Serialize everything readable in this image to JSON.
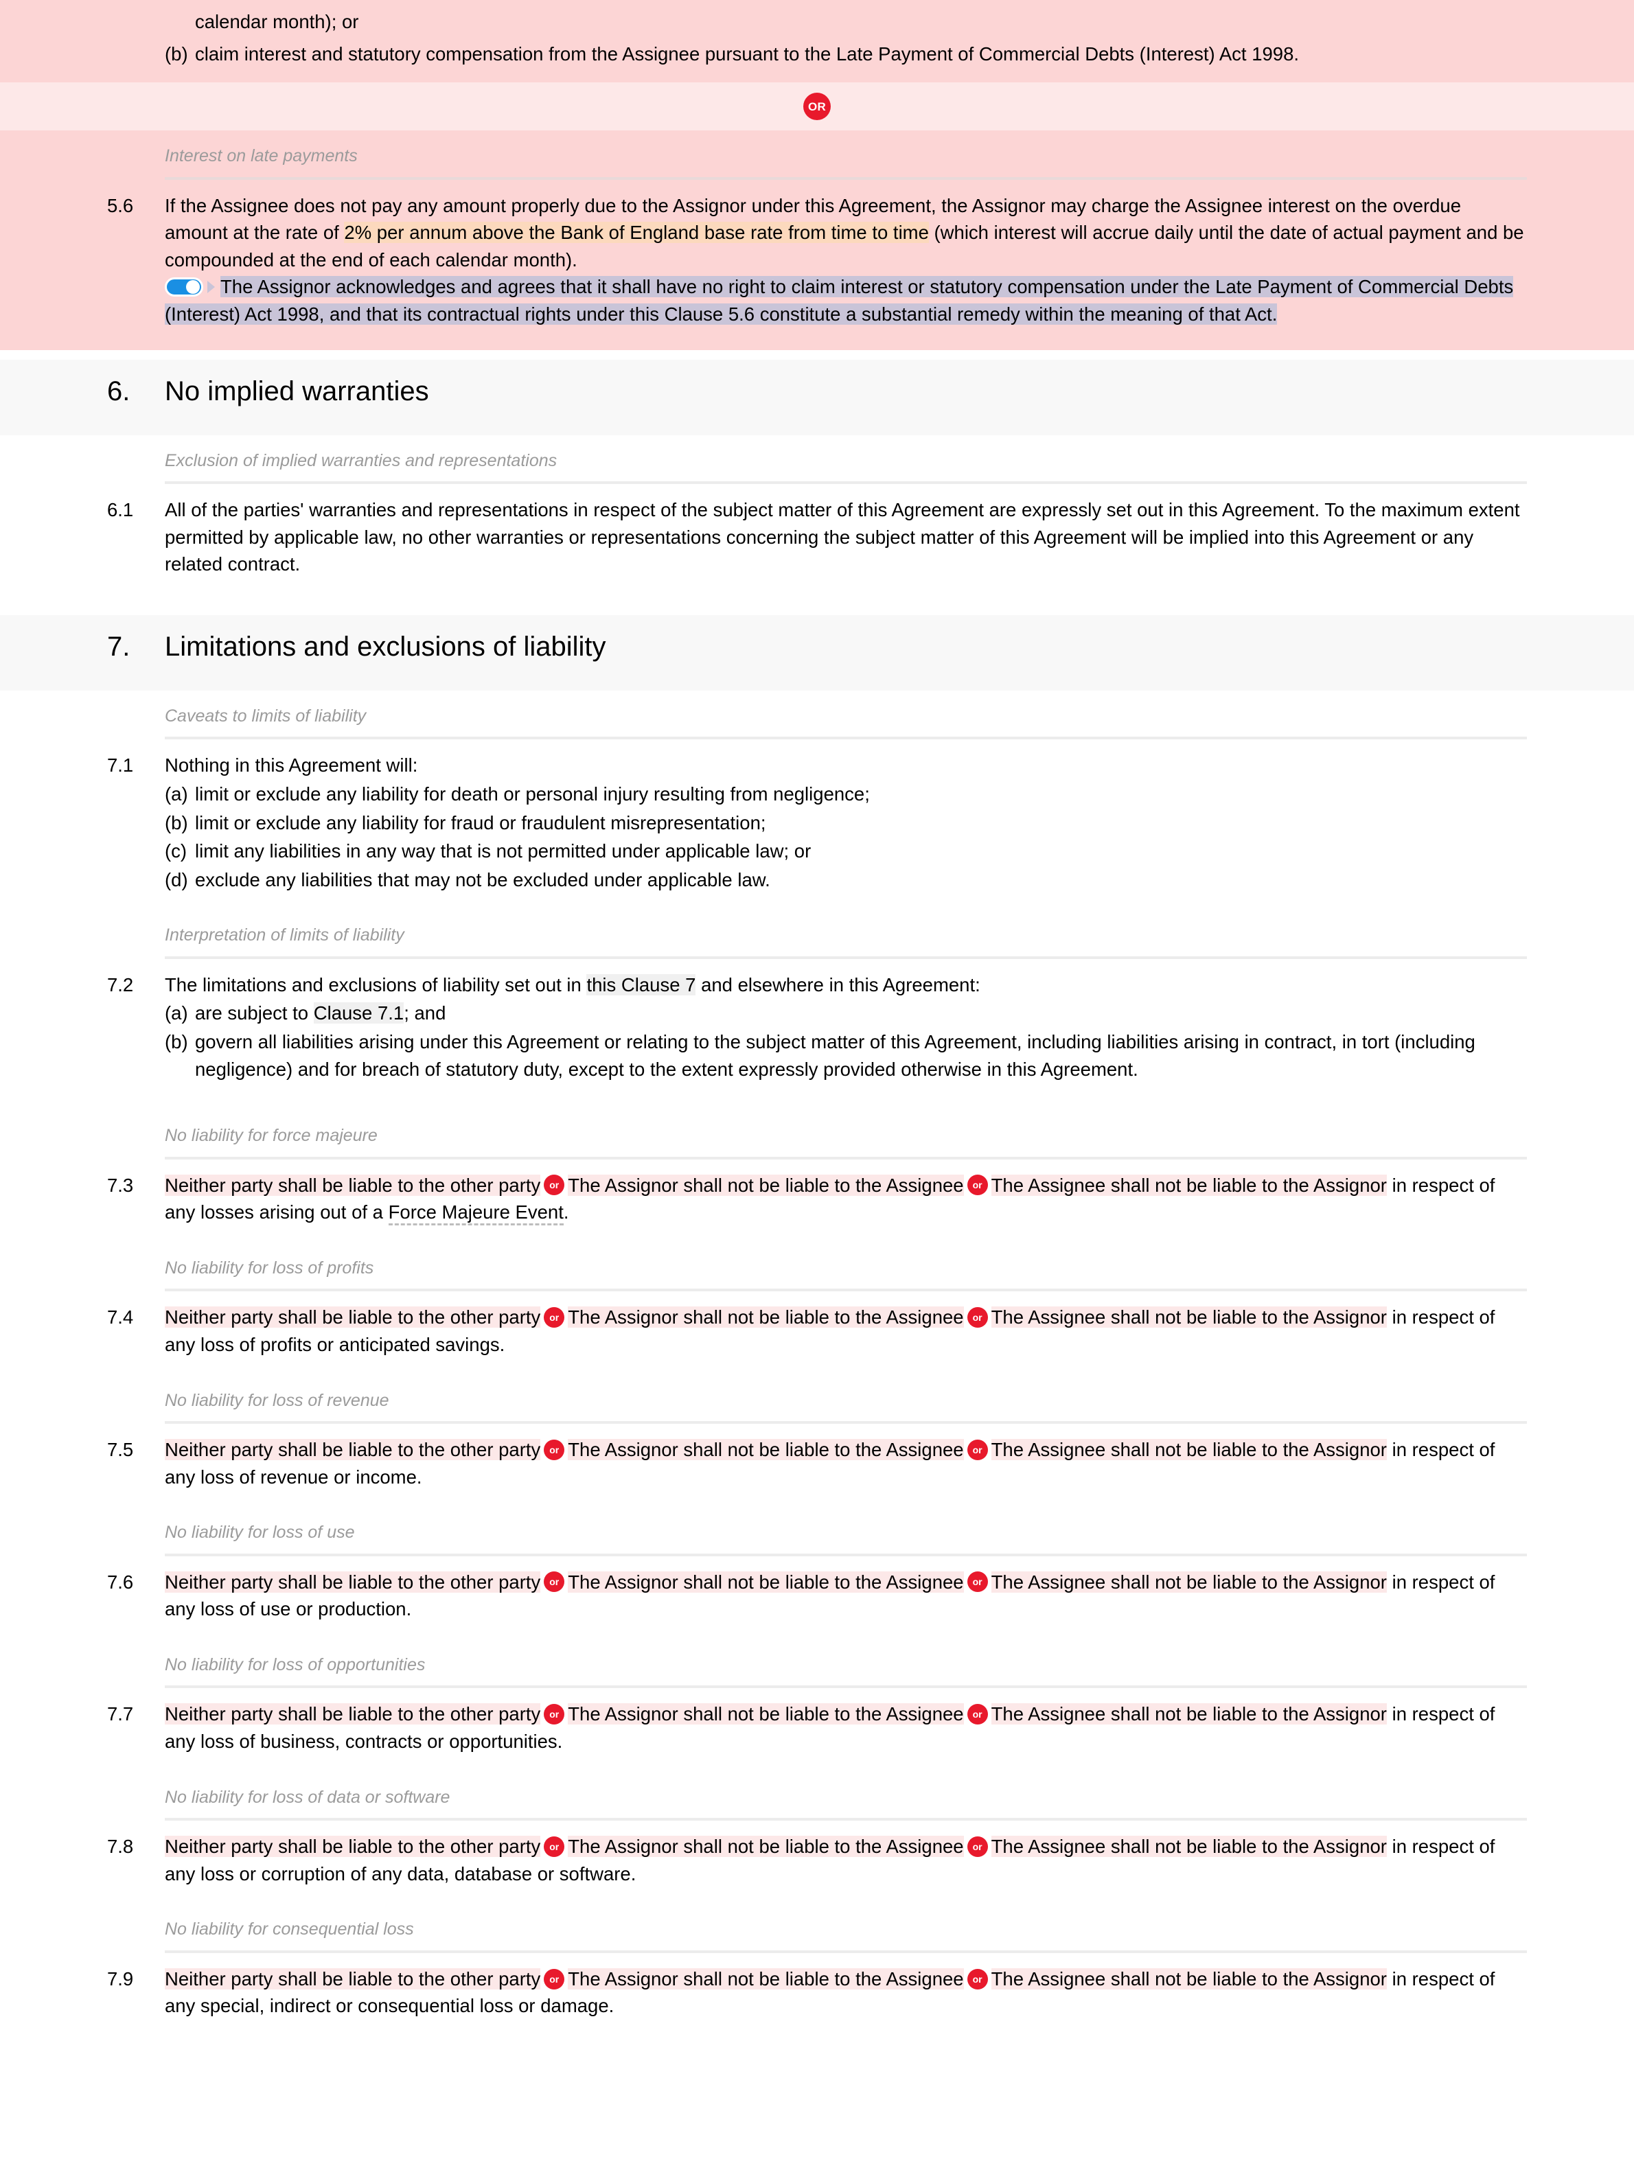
{
  "colors": {
    "alt_block_bg": "#fcd5d5",
    "or_divider_bg": "#fde8e8",
    "or_badge_bg": "#e8192c",
    "option_highlight": "#fce8e8",
    "variable_highlight": "#fcd9bd",
    "optional_highlight": "#c9c4d8",
    "cross_reference_highlight": "#f0f0f0",
    "section_heading_bg": "#f8f8f8",
    "toggle_on": "#1a8fe3"
  },
  "top_alt_block": {
    "continuation_text": "calendar month); or",
    "list_item": {
      "marker": "(b)",
      "text": "claim interest and statutory compensation from the Assignee pursuant to the Late Payment of Commercial Debts (Interest) Act 1998."
    }
  },
  "or_divider": {
    "label": "OR"
  },
  "clause_5_6": {
    "subheading": "Interest on late payments",
    "number": "5.6",
    "text_part_1": "If the Assignee does not pay any amount properly due to the Assignor under this Agreement, the Assignor may charge the Assignee interest on the overdue amount at the rate of ",
    "variable_rate": "2% per annum above the Bank of England base rate from time to time",
    "text_part_2": " (which interest will accrue daily until the date of actual payment and be compounded at the end of each calendar month).",
    "toggle_state": "on",
    "optional_text": "The Assignor acknowledges and agrees that it shall have no right to claim interest or statutory compensation under the Late Payment of Commercial Debts (Interest) Act 1998, and that its contractual rights under this Clause 5.6 constitute a substantial remedy within the meaning of that Act."
  },
  "section_6": {
    "number": "6.",
    "title": "No implied warranties",
    "subheading": "Exclusion of implied warranties and representations",
    "clause_6_1": {
      "number": "6.1",
      "text": "All of the parties' warranties and representations in respect of the subject matter of this Agreement are expressly set out in this Agreement. To the maximum extent permitted by applicable law, no other warranties or representations concerning the subject matter of this Agreement will be implied into this Agreement or any related contract."
    }
  },
  "section_7": {
    "number": "7.",
    "title": "Limitations and exclusions of liability",
    "clause_7_1": {
      "subheading": "Caveats to limits of liability",
      "number": "7.1",
      "lead": "Nothing in this Agreement will:",
      "items": [
        {
          "marker": "(a)",
          "text": "limit or exclude any liability for death or personal injury resulting from negligence;"
        },
        {
          "marker": "(b)",
          "text": "limit or exclude any liability for fraud or fraudulent misrepresentation;"
        },
        {
          "marker": "(c)",
          "text": "limit any liabilities in any way that is not permitted under applicable law; or"
        },
        {
          "marker": "(d)",
          "text": "exclude any liabilities that may not be excluded under applicable law."
        }
      ]
    },
    "clause_7_2": {
      "subheading": "Interpretation of limits of liability",
      "number": "7.2",
      "lead_before_ref": "The limitations and exclusions of liability set out in ",
      "lead_ref": "this Clause 7",
      "lead_after_ref": " and elsewhere in this Agreement:",
      "item_a": {
        "marker": "(a)",
        "before_ref": "are subject to ",
        "ref": "Clause 7.1",
        "after_ref": "; and"
      },
      "item_b": {
        "marker": "(b)",
        "text": "govern all liabilities arising under this Agreement or relating to the subject matter of this Agreement, including liabilities arising in contract, in tort (including negligence) and for breach of statutory duty, except to the extent expressly provided otherwise in this Agreement."
      }
    },
    "liability_clauses": [
      {
        "subheading": "No liability for force majeure",
        "number": "7.3",
        "option_1": "Neither party shall be liable to the other party",
        "or_label": "or",
        "option_2": "The Assignor shall not be liable to the Assignee",
        "option_3": "The Assignee shall not be liable to the Assignor",
        "tail_before_term": " in respect of any losses arising out of a ",
        "defined_term": "Force Majeure Event",
        "tail_after_term": "."
      },
      {
        "subheading": "No liability for loss of profits",
        "number": "7.4",
        "option_1": "Neither party shall be liable to the other party",
        "or_label": "or",
        "option_2": "The Assignor shall not be liable to the Assignee",
        "option_3": "The Assignee shall not be liable to the Assignor",
        "tail_before_term": " in respect of any loss of profits or anticipated savings.",
        "defined_term": "",
        "tail_after_term": ""
      },
      {
        "subheading": "No liability for loss of revenue",
        "number": "7.5",
        "option_1": "Neither party shall be liable to the other party",
        "or_label": "or",
        "option_2": "The Assignor shall not be liable to the Assignee",
        "option_3": "The Assignee shall not be liable to the Assignor",
        "tail_before_term": " in respect of any loss of revenue or income.",
        "defined_term": "",
        "tail_after_term": ""
      },
      {
        "subheading": "No liability for loss of use",
        "number": "7.6",
        "option_1": "Neither party shall be liable to the other party",
        "or_label": "or",
        "option_2": "The Assignor shall not be liable to the Assignee",
        "option_3": "The Assignee shall not be liable to the Assignor",
        "tail_before_term": " in respect of any loss of use or production.",
        "defined_term": "",
        "tail_after_term": ""
      },
      {
        "subheading": "No liability for loss of opportunities",
        "number": "7.7",
        "option_1": "Neither party shall be liable to the other party",
        "or_label": "or",
        "option_2": "The Assignor shall not be liable to the Assignee",
        "option_3": "The Assignee shall not be liable to the Assignor",
        "tail_before_term": " in respect of any loss of business, contracts or opportunities.",
        "defined_term": "",
        "tail_after_term": ""
      },
      {
        "subheading": "No liability for loss of data or software",
        "number": "7.8",
        "option_1": "Neither party shall be liable to the other party",
        "or_label": "or",
        "option_2": "The Assignor shall not be liable to the Assignee",
        "option_3": "The Assignee shall not be liable to the Assignor",
        "tail_before_term": " in respect of any loss or corruption of any data, database or software.",
        "defined_term": "",
        "tail_after_term": ""
      },
      {
        "subheading": "No liability for consequential loss",
        "number": "7.9",
        "option_1": "Neither party shall be liable to the other party",
        "or_label": "or",
        "option_2": "The Assignor shall not be liable to the Assignee",
        "option_3": "The Assignee shall not be liable to the Assignor",
        "tail_before_term": " in respect of any special, indirect or consequential loss or damage.",
        "defined_term": "",
        "tail_after_term": ""
      }
    ]
  }
}
